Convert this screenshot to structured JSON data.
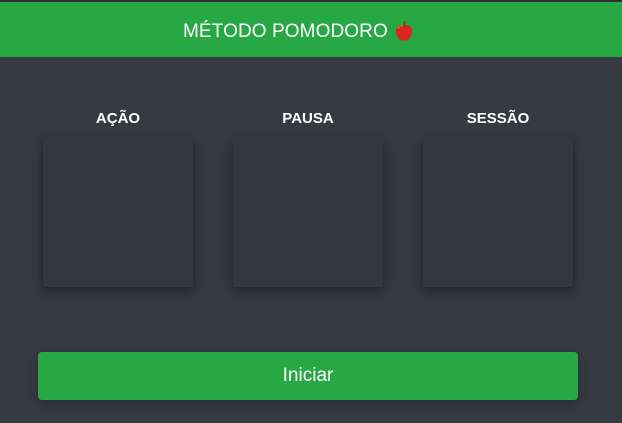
{
  "header": {
    "title": "MÉTODO POMODORO",
    "icon": "apple-icon",
    "background": "#28a745"
  },
  "columns": [
    {
      "label": "AÇÃO",
      "value": ""
    },
    {
      "label": "PAUSA",
      "value": ""
    },
    {
      "label": "SESSÃO",
      "value": ""
    }
  ],
  "controls": {
    "start_label": "Iniciar"
  },
  "colors": {
    "page_background": "#353a43",
    "card_background": "#323741",
    "accent": "#28a745",
    "text": "#ffffff"
  }
}
